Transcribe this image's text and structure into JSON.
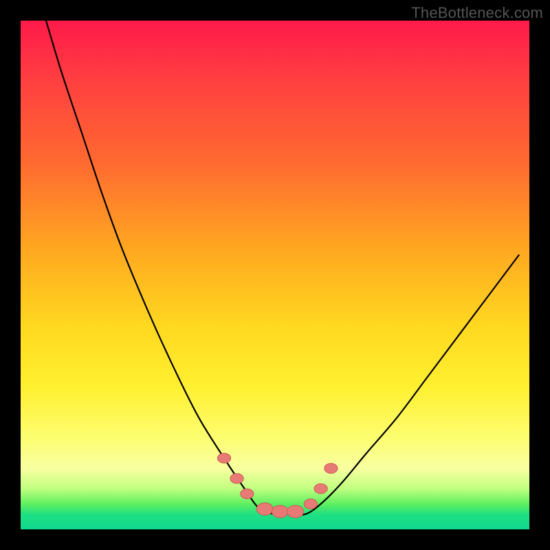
{
  "watermark": "TheBottleneck.com",
  "colors": {
    "frame": "#000000",
    "curve": "#000000",
    "marker_fill": "#e77a74",
    "marker_stroke": "#c95b55"
  },
  "chart_data": {
    "type": "line",
    "title": "",
    "xlabel": "",
    "ylabel": "",
    "xlim": [
      0,
      100
    ],
    "ylim": [
      0,
      100
    ],
    "grid": false,
    "note": "Axes are implicit (no ticks/labels). x = horizontal position as % of plot width, y = vertical performance/fit as % (100 = top of gradient, 0 = bottom).",
    "series": [
      {
        "name": "bottleneck-curve",
        "x": [
          5,
          8,
          12,
          16,
          20,
          25,
          30,
          35,
          40,
          44,
          47,
          50,
          53,
          56,
          59,
          63,
          68,
          74,
          80,
          86,
          92,
          98
        ],
        "y": [
          100,
          90,
          78,
          66,
          55,
          43,
          32,
          22,
          14,
          8,
          4,
          3,
          3,
          3,
          5,
          9,
          15,
          22,
          30,
          38,
          46,
          54
        ]
      }
    ],
    "markers": {
      "name": "highlight-points",
      "x": [
        40,
        42.5,
        44.5,
        48,
        51,
        54,
        57,
        59,
        61
      ],
      "y": [
        14,
        10,
        7,
        4,
        3.5,
        3.5,
        5,
        8,
        12
      ],
      "size": [
        8,
        8,
        8,
        10,
        10,
        10,
        8,
        8,
        8
      ]
    },
    "gradient_stops": [
      {
        "pct": 0,
        "color": "#ff1a4a"
      },
      {
        "pct": 12,
        "color": "#ff4040"
      },
      {
        "pct": 28,
        "color": "#ff6a30"
      },
      {
        "pct": 45,
        "color": "#ffa820"
      },
      {
        "pct": 60,
        "color": "#ffd820"
      },
      {
        "pct": 72,
        "color": "#fff030"
      },
      {
        "pct": 82,
        "color": "#fdfd70"
      },
      {
        "pct": 88,
        "color": "#f8ffa0"
      },
      {
        "pct": 92,
        "color": "#c0ff80"
      },
      {
        "pct": 95,
        "color": "#60f060"
      },
      {
        "pct": 97,
        "color": "#20e080"
      },
      {
        "pct": 100,
        "color": "#10d890"
      }
    ]
  }
}
